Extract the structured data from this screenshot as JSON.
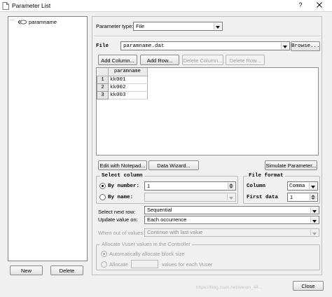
{
  "window": {
    "title": "Parameter List",
    "help_button": "?"
  },
  "tree": {
    "items": [
      {
        "label": "paramname"
      }
    ]
  },
  "left_buttons": {
    "new": "New",
    "delete": "Delete"
  },
  "parameter_type": {
    "label": "Parameter type:",
    "value": "File"
  },
  "file": {
    "label": "File",
    "value": "paramname.dat",
    "browse": "Browse..."
  },
  "table_buttons": {
    "add_column": "Add Column...",
    "add_row": "Add Row...",
    "delete_column": "Delete Column...",
    "delete_row": "Delete Row..."
  },
  "table": {
    "header": "paramname",
    "rows": [
      {
        "num": "1",
        "value": "kk001"
      },
      {
        "num": "2",
        "value": "kk002"
      },
      {
        "num": "3",
        "value": "kk003"
      }
    ]
  },
  "action_buttons": {
    "edit_notepad": "Edit with Notepad...",
    "data_wizard": "Data Wizard...",
    "simulate": "Simulate Parameter..."
  },
  "select_column": {
    "title": "Select column",
    "by_number": {
      "label": "By number:",
      "value": "1",
      "selected": true
    },
    "by_name": {
      "label": "By name:",
      "value": "",
      "selected": false
    }
  },
  "file_format": {
    "title": "File format",
    "column": {
      "label": "Column",
      "value": "Comma"
    },
    "first_data": {
      "label": "First data",
      "value": "1"
    }
  },
  "select_next_row": {
    "label": "Select next row:",
    "value": "Sequential"
  },
  "update_value_on": {
    "label": "Update value on:",
    "value": "Each occurrence"
  },
  "when_out_of_values": {
    "label": "When out of values:",
    "value": "Continue with last value"
  },
  "allocate": {
    "title": "Allocate Vuser values in the Controller",
    "auto": {
      "label": "Automatically allocate block size",
      "selected": true
    },
    "manual": {
      "label": "Allocate",
      "value": "",
      "suffix": "values for each Vuser",
      "selected": false
    }
  },
  "footer": {
    "close": "Close",
    "watermark": "https://blog.csdn.net/weixin_44..."
  }
}
